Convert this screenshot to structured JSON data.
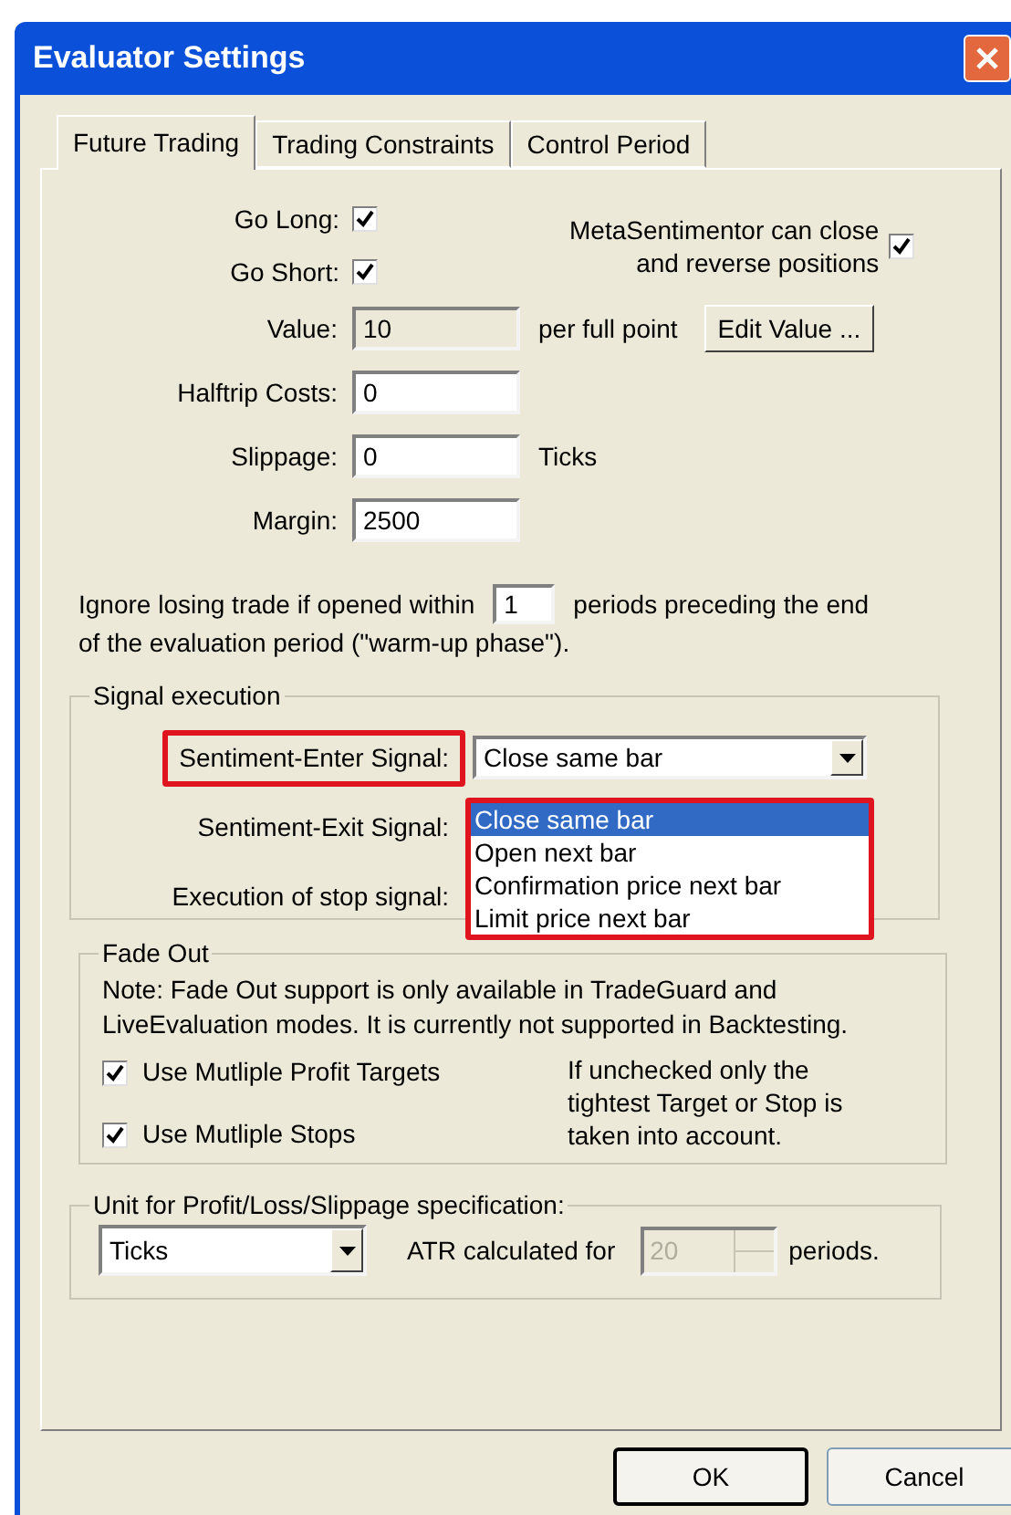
{
  "window": {
    "title": "Evaluator Settings"
  },
  "tabs": [
    {
      "label": "Future Trading",
      "selected": true
    },
    {
      "label": "Trading Constraints",
      "selected": false
    },
    {
      "label": "Control Period",
      "selected": false
    }
  ],
  "direction_checks": [
    {
      "label": "Go Long:",
      "checked": true
    },
    {
      "label": "Go Short:",
      "checked": true
    }
  ],
  "reverse_option": {
    "lines": [
      "MetaSentimentor can close",
      "and reverse positions"
    ],
    "checked": true
  },
  "fields": [
    {
      "label": "Value:",
      "value": "10",
      "disabled": true,
      "suffix": "per full point"
    },
    {
      "label": "Halftrip Costs:",
      "value": "0",
      "disabled": false
    },
    {
      "label": "Slippage:",
      "value": "0",
      "disabled": false,
      "suffix": "Ticks"
    },
    {
      "label": "Margin:",
      "value": "2500",
      "disabled": false
    }
  ],
  "edit_value_button": "Edit Value ...",
  "warmup": {
    "before": "Ignore losing trade if opened within",
    "value": "1",
    "after": "periods preceding the end",
    "line2": "of the evaluation period (\"warm-up phase\")."
  },
  "signal_execution": {
    "title": "Signal execution",
    "rows": [
      {
        "label": "Sentiment-Enter Signal:",
        "highlighted": true,
        "value": "Close same bar"
      },
      {
        "label": "Sentiment-Exit Signal:",
        "highlighted": false
      },
      {
        "label": "Execution of stop signal:",
        "highlighted": false
      }
    ],
    "dropdown": {
      "highlighted": true,
      "options": [
        {
          "label": "Close same bar",
          "selected": true
        },
        {
          "label": "Open next bar",
          "selected": false
        },
        {
          "label": "Confirmation price next bar",
          "selected": false
        },
        {
          "label": "Limit price next bar",
          "selected": false
        }
      ]
    }
  },
  "fade_out": {
    "title": "Fade Out",
    "note": [
      "Note: Fade Out support is only available in TradeGuard and",
      "LiveEvaluation modes. It is currently not supported in Backtesting."
    ],
    "checks": [
      {
        "label": "Use Mutliple Profit Targets",
        "checked": true
      },
      {
        "label": "Use Mutliple Stops",
        "checked": true
      }
    ],
    "hint": [
      "If unchecked only the",
      "tightest Target or Stop is",
      "taken into account."
    ]
  },
  "unit": {
    "title": "Unit for Profit/Loss/Slippage specification:",
    "value": "Ticks",
    "atr_label": "ATR calculated for",
    "atr_value": "20",
    "atr_disabled": true,
    "atr_suffix": "periods."
  },
  "buttons": [
    {
      "label": "OK",
      "default": true
    },
    {
      "label": "Cancel",
      "default": false
    }
  ]
}
